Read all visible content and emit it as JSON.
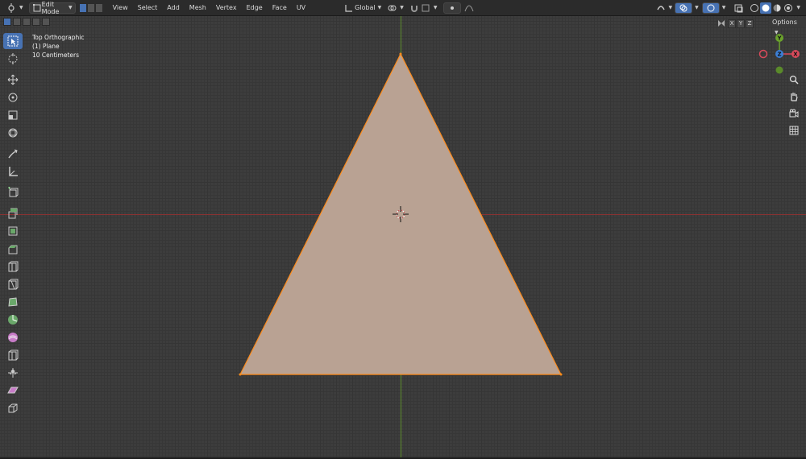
{
  "header": {
    "editor_type_icon": "3d-viewport-icon",
    "mode_label": "Edit Mode",
    "menus": [
      "View",
      "Select",
      "Add",
      "Mesh",
      "Vertex",
      "Edge",
      "Face",
      "UV"
    ],
    "orientation_label": "Global",
    "right_icons": [
      "gizmo-icon",
      "overlay-icon",
      "xray-icon",
      "shading-wireframe-icon",
      "shading-solid-icon",
      "shading-material-icon",
      "shading-rendered-icon"
    ]
  },
  "viewport": {
    "info_lines": [
      "Top Orthographic",
      "(1) Plane",
      "10 Centimeters"
    ],
    "options_label": "Options",
    "mirror_axes": [
      "X",
      "Y",
      "Z"
    ],
    "gizmo_axes": {
      "y": "Y",
      "x": "X",
      "z": "Z"
    },
    "colors": {
      "background": "#3d3d3d",
      "face": "#b9a293",
      "edge": "#ff8c1a",
      "axis_x": "#8a3232",
      "axis_y": "#5a8a2a",
      "selection_blue": "#4772b3"
    }
  },
  "toolbar": {
    "tools": [
      "select-box-icon",
      "cursor-icon",
      "move-icon",
      "rotate-icon",
      "scale-icon",
      "transform-icon",
      "annotate-icon",
      "measure-icon",
      "add-cube-icon",
      "extrude-region-icon",
      "inset-faces-icon",
      "bevel-icon",
      "loop-cut-icon",
      "knife-icon",
      "poly-build-icon",
      "spin-icon",
      "smooth-icon",
      "edge-slide-icon",
      "shrink-fatten-icon",
      "shear-icon",
      "rip-region-icon"
    ]
  },
  "navigation": [
    "zoom-icon",
    "pan-hand-icon",
    "camera-icon",
    "grid-perspective-icon"
  ]
}
